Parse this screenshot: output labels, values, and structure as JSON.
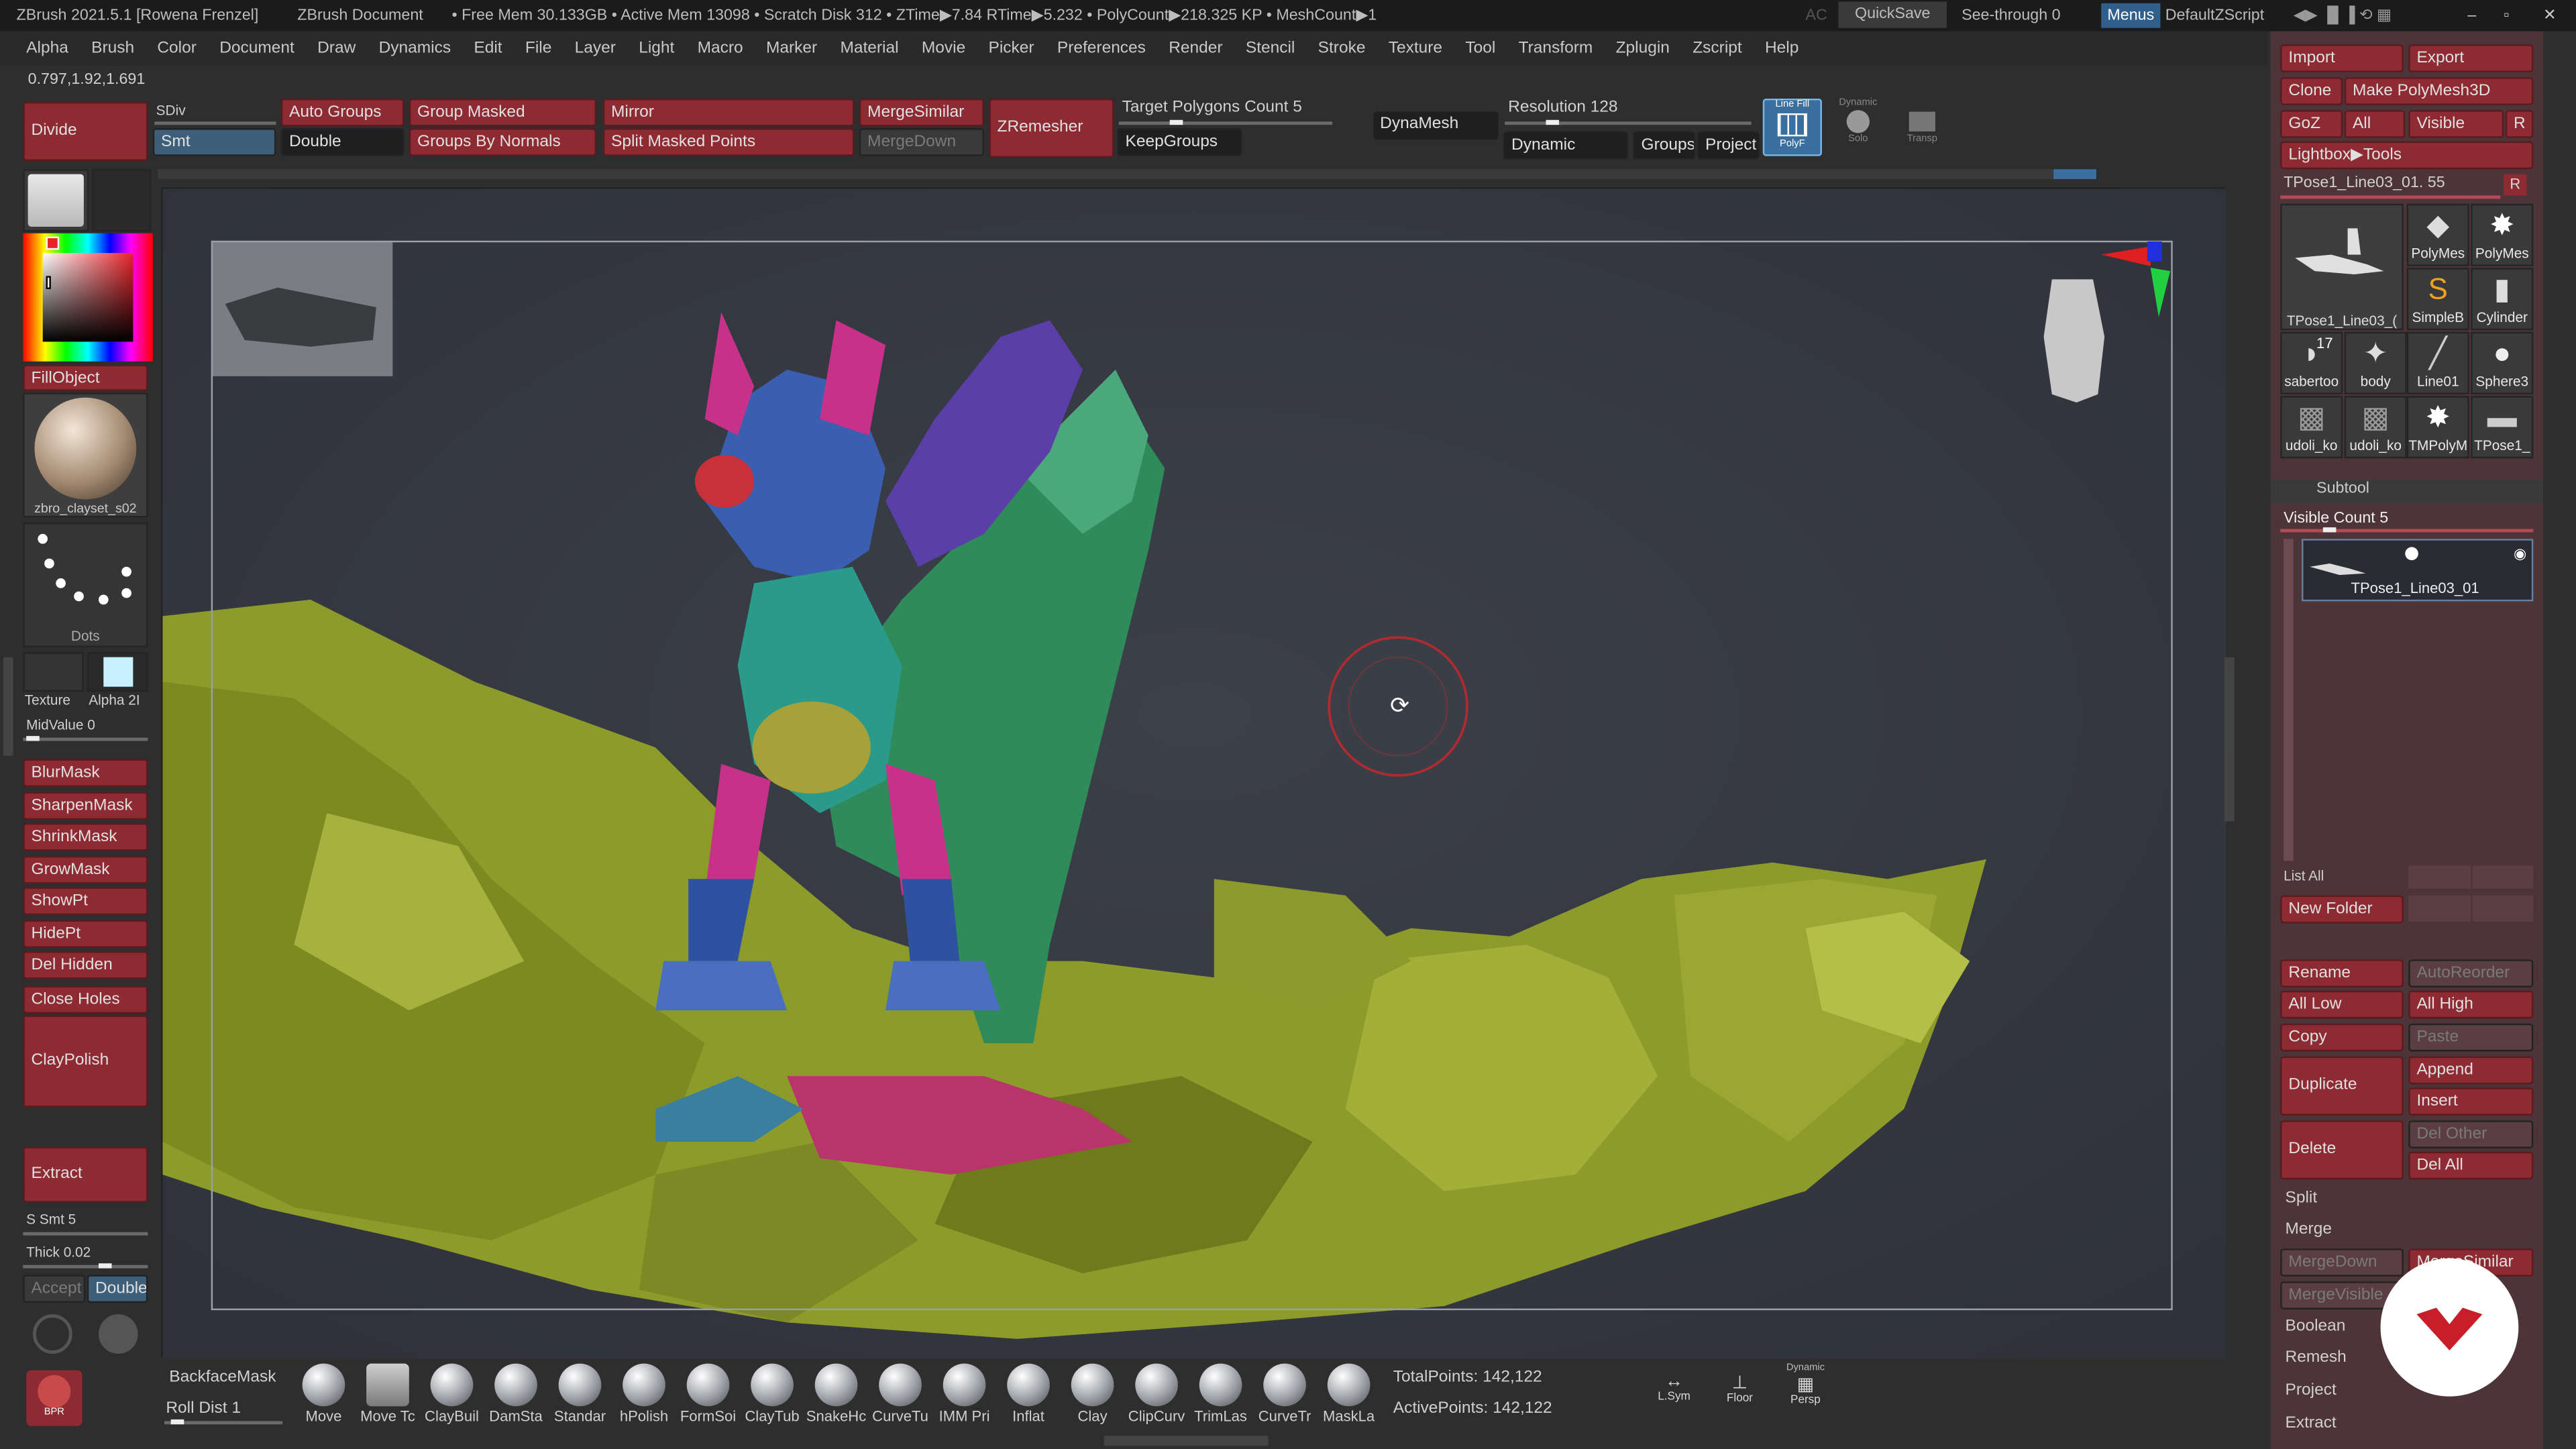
{
  "titlebar": {
    "app": "ZBrush 2021.5.1 [Rowena Frenzel]",
    "doc": "ZBrush Document",
    "stats": "• Free Mem 30.133GB • Active Mem 13098 • Scratch Disk 312 • ZTime▶7.84 RTime▶5.232 • PolyCount▶218.325 KP • MeshCount▶1",
    "ac": "AC",
    "quicksave": "QuickSave",
    "seethrough": "See-through 0",
    "menus": "Menus",
    "script": "DefaultZScript"
  },
  "menubar": [
    "Alpha",
    "Brush",
    "Color",
    "Document",
    "Draw",
    "Dynamics",
    "Edit",
    "File",
    "Layer",
    "Light",
    "Macro",
    "Marker",
    "Material",
    "Movie",
    "Picker",
    "Preferences",
    "Render",
    "Stencil",
    "Stroke",
    "Texture",
    "Tool",
    "Transform",
    "Zplugin",
    "Zscript",
    "Help"
  ],
  "coords": "0.797,1.92,1.691",
  "toolbar": {
    "divide": "Divide",
    "sdiv": "SDiv",
    "smt": "Smt",
    "auto_groups": "Auto Groups",
    "double": "Double",
    "group_masked": "Group Masked",
    "groups_by_normals": "Groups By Normals",
    "mirror": "Mirror",
    "split_masked": "Split Masked Points",
    "mergesimilar": "MergeSimilar",
    "mergedown": "MergeDown",
    "zremesher": "ZRemesher",
    "target": "Target Polygons Count 5",
    "keepgroups": "KeepGroups",
    "dynamesh": "DynaMesh",
    "resolution": "Resolution 128",
    "dynamic": "Dynamic",
    "groups": "Groups",
    "project": "Project",
    "polyf": "PolyF",
    "linefill": "Line Fill",
    "solo": "Solo",
    "dynamic_small": "Dynamic",
    "transp": "Transp"
  },
  "left": {
    "fillobject": "FillObject",
    "material": "zbro_clayset_s02",
    "stroke": "Dots",
    "texture": "Texture",
    "alpha": "Alpha 2I",
    "midvalue": "MidValue 0",
    "mask_buttons": [
      "BlurMask",
      "SharpenMask",
      "ShrinkMask",
      "GrowMask",
      "ShowPt",
      "HidePt",
      "Del Hidden",
      "Close Holes"
    ],
    "claypolish": "ClayPolish",
    "extract": "Extract",
    "ssmt": "S Smt 5",
    "thick": "Thick 0.02",
    "accept": "Accept",
    "double": "Double",
    "bpr": "BPR"
  },
  "bottom": {
    "backface": "BackfaceMask",
    "rolldist": "Roll Dist 1",
    "total": "TotalPoints: 142,122",
    "active": "ActivePoints: 142,122",
    "lsym": "L.Sym",
    "floor": "Floor",
    "persp": "Persp",
    "dynamic": "Dynamic"
  },
  "brushes": [
    "Move",
    "Move Tc",
    "ClayBuil",
    "DamSta",
    "Standar",
    "hPolish",
    "FormSoi",
    "ClayTub",
    "SnakeHc",
    "CurveTu",
    "IMM Pri",
    "Inflat",
    "Clay",
    "ClipCurv",
    "TrimLas",
    "CurveTr",
    "MaskLa"
  ],
  "right": {
    "import": "Import",
    "export": "Export",
    "clone": "Clone",
    "make_polymesh": "Make PolyMesh3D",
    "goz": "GoZ",
    "all": "All",
    "visible": "Visible",
    "r": "R",
    "lightbox": "Lightbox▶Tools",
    "tool_name": "TPose1_Line03_01. 55",
    "tools": [
      "TPose1_Line03_(",
      "PolyMes",
      "PolyMes",
      "SimpleB",
      "Cylinder",
      "sabertoo",
      "body",
      "Line01",
      "Sphere3",
      "udoli_ko",
      "udoli_ko",
      "TMPolyM",
      "TPose1_"
    ],
    "badge17": "17",
    "subtool": "Subtool",
    "visible_count": "Visible Count 5",
    "subtool_item": "TPose1_Line03_01",
    "list_all": "List All",
    "new_folder": "New Folder",
    "rename": "Rename",
    "autoreorder": "AutoReorder",
    "all_low": "All Low",
    "all_high": "All High",
    "copy": "Copy",
    "paste": "Paste",
    "duplicate": "Duplicate",
    "append": "Append",
    "insert": "Insert",
    "delete": "Delete",
    "del_other": "Del Other",
    "del_all": "Del All",
    "split": "Split",
    "merge": "Merge",
    "mergedown": "MergeDown",
    "mergesimilar": "MergeSimilar",
    "mergevisible": "MergeVisible",
    "boolean": "Boolean",
    "remesh": "Remesh",
    "project": "Project",
    "extract": "Extract"
  },
  "colors": {
    "accent_red": "#8e2a32",
    "canvas": "#383c45",
    "panel": "#2e2e2e",
    "ground": "#8a9a2a"
  }
}
